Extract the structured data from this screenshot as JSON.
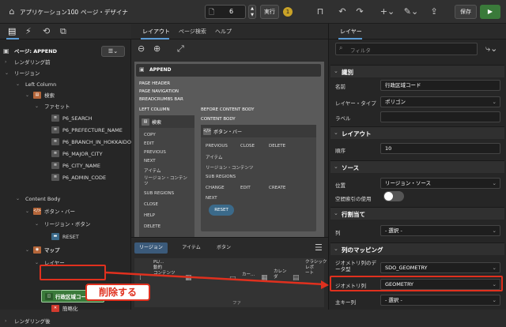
{
  "topbar": {
    "app_title": "アプリケーション100",
    "page_title": "ページ・デザイナ",
    "page_number": "6",
    "run_label": "実行",
    "save_label": "保存",
    "badge_count": "1"
  },
  "left_panel": {
    "tree": [
      {
        "label": "ページ: APPEND",
        "level": 0
      },
      {
        "label": "レンダリング前",
        "level": 0
      },
      {
        "label": "リージョン",
        "level": 0
      },
      {
        "label": "Left Column",
        "level": 1
      },
      {
        "label": "検索",
        "level": 2
      },
      {
        "label": "ファセット",
        "level": 3
      },
      {
        "label": "P6_SEARCH",
        "level": 4
      },
      {
        "label": "P6_PREFECTURE_NAME",
        "level": 4
      },
      {
        "label": "P6_BRANCH_IN_HOKKAIDO",
        "level": 4
      },
      {
        "label": "P6_MAJOR_CITY",
        "level": 4
      },
      {
        "label": "P6_CITY_NAME",
        "level": 4
      },
      {
        "label": "P6_ADMIN_CODE",
        "level": 4
      },
      {
        "label": "Content Body",
        "level": 1
      },
      {
        "label": "ボタン・バー",
        "level": 2
      },
      {
        "label": "リージョン・ボタン",
        "level": 3
      },
      {
        "label": "RESET",
        "level": 4
      },
      {
        "label": "マップ",
        "level": 2
      },
      {
        "label": "レイヤー",
        "level": 3
      },
      {
        "label": "行政区域コード",
        "level": 4
      },
      {
        "label": "簡略化",
        "level": 4
      },
      {
        "label": "レンダリング後",
        "level": 0
      }
    ]
  },
  "middle_panel": {
    "tabs": [
      "レイアウト",
      "ページ検索",
      "ヘルプ"
    ],
    "append_title": "APPEND",
    "page_header": "PAGE HEADER",
    "page_navigation": "PAGE NAVIGATION",
    "breadcrumbs_bar": "BREADCRUMBS BAR",
    "left_column": "LEFT COLUMN",
    "before_content_body": "BEFORE CONTENT BODY",
    "content_body": "CONTENT BODY",
    "search_region": "検索",
    "button_bar": "ボタン・バー",
    "left_items": [
      "COPY",
      "EDIT",
      "PREVIOUS",
      "NEXT",
      "アイテム",
      "リージョン・コンテンツ",
      "SUB REGIONS",
      "CLOSE",
      "HELP",
      "DELETE"
    ],
    "bb_row1": [
      "PREVIOUS",
      "CLOSE",
      "DELETE"
    ],
    "bb_items": [
      "アイテム",
      "リージョン・コンテンツ",
      "SUB REGIONS"
    ],
    "bb_row2": [
      "CHANGE",
      "EDIT",
      "CREATE"
    ],
    "bb_next": "NEXT",
    "reset_label": "RESET",
    "bottom_tabs": [
      "リージョン",
      "アイテム",
      "ボタン"
    ],
    "gallery": [
      "PL/...\n動的\nコンテンツ",
      "カー...",
      "カレン\nダ",
      "クラシック・\nレポ\nート"
    ],
    "gallery_footer": "ファ"
  },
  "right_panel": {
    "tab": "レイヤー",
    "filter_placeholder": "フィルタ",
    "sections": {
      "identification": "識別",
      "layout": "レイアウト",
      "source": "ソース",
      "row_assignment": "行割当て",
      "column_mapping": "列のマッピング"
    },
    "fields": {
      "name_label": "名前",
      "name_value": "行政区域コード",
      "layer_type_label": "レイヤー・タイプ",
      "layer_type_value": "ポリゴン",
      "label_label": "ラベル",
      "sequence_label": "順序",
      "sequence_value": "10",
      "location_label": "位置",
      "location_value": "リージョン・ソース",
      "spatial_index_label": "空間索引の使用",
      "column_label": "列",
      "column_value": "- 選択 -",
      "geometry_type_label": "ジオメトリ列のデータ型",
      "geometry_type_value": "SDO_GEOMETRY",
      "geometry_column_label": "ジオメトリ列",
      "geometry_column_value": "GEOMETRY",
      "primary_key_label": "主キー列",
      "primary_key_value": "- 選択 -"
    }
  },
  "annotation": {
    "text": "削除する"
  },
  "colors": {
    "accent_green": "#3a7a3a",
    "highlight_red": "#e0301e",
    "primary_blue": "#3b6a8a"
  }
}
